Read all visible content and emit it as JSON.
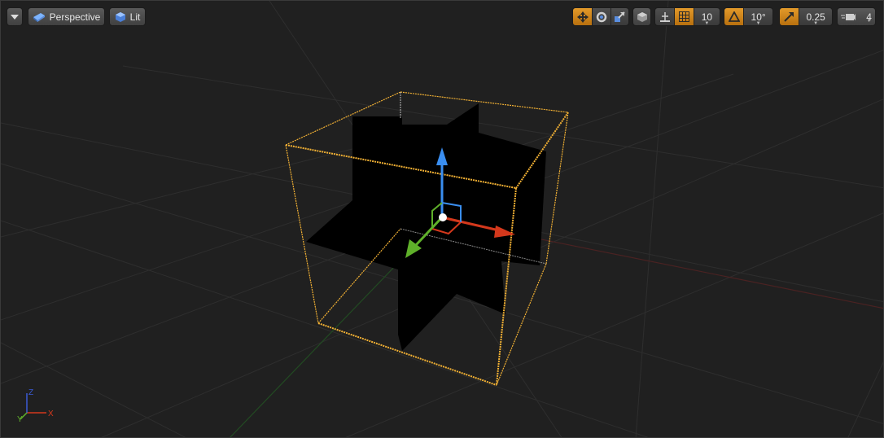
{
  "toolbar": {
    "view_mode_label": "Perspective",
    "lighting_label": "Lit",
    "grid_snap_value": "10",
    "rotation_snap_value": "10°",
    "scale_snap_value": "0.25",
    "camera_speed_value": "4"
  },
  "axis_indicator": {
    "x": "X",
    "y": "Y",
    "z": "Z"
  },
  "colors": {
    "accent": "#e39a2a",
    "selection": "#f2b134",
    "x_axis": "#d4381c",
    "y_axis": "#5fb02a",
    "z_axis": "#3a8ef0"
  },
  "icons": [
    "chevron-down-icon",
    "perspective-cube-icon",
    "lit-sphere-icon",
    "translate-icon",
    "rotate-icon",
    "scale-icon",
    "world-space-icon",
    "surface-snap-icon",
    "grid-snap-icon",
    "rotation-snap-icon",
    "scale-snap-icon",
    "camera-speed-icon"
  ]
}
